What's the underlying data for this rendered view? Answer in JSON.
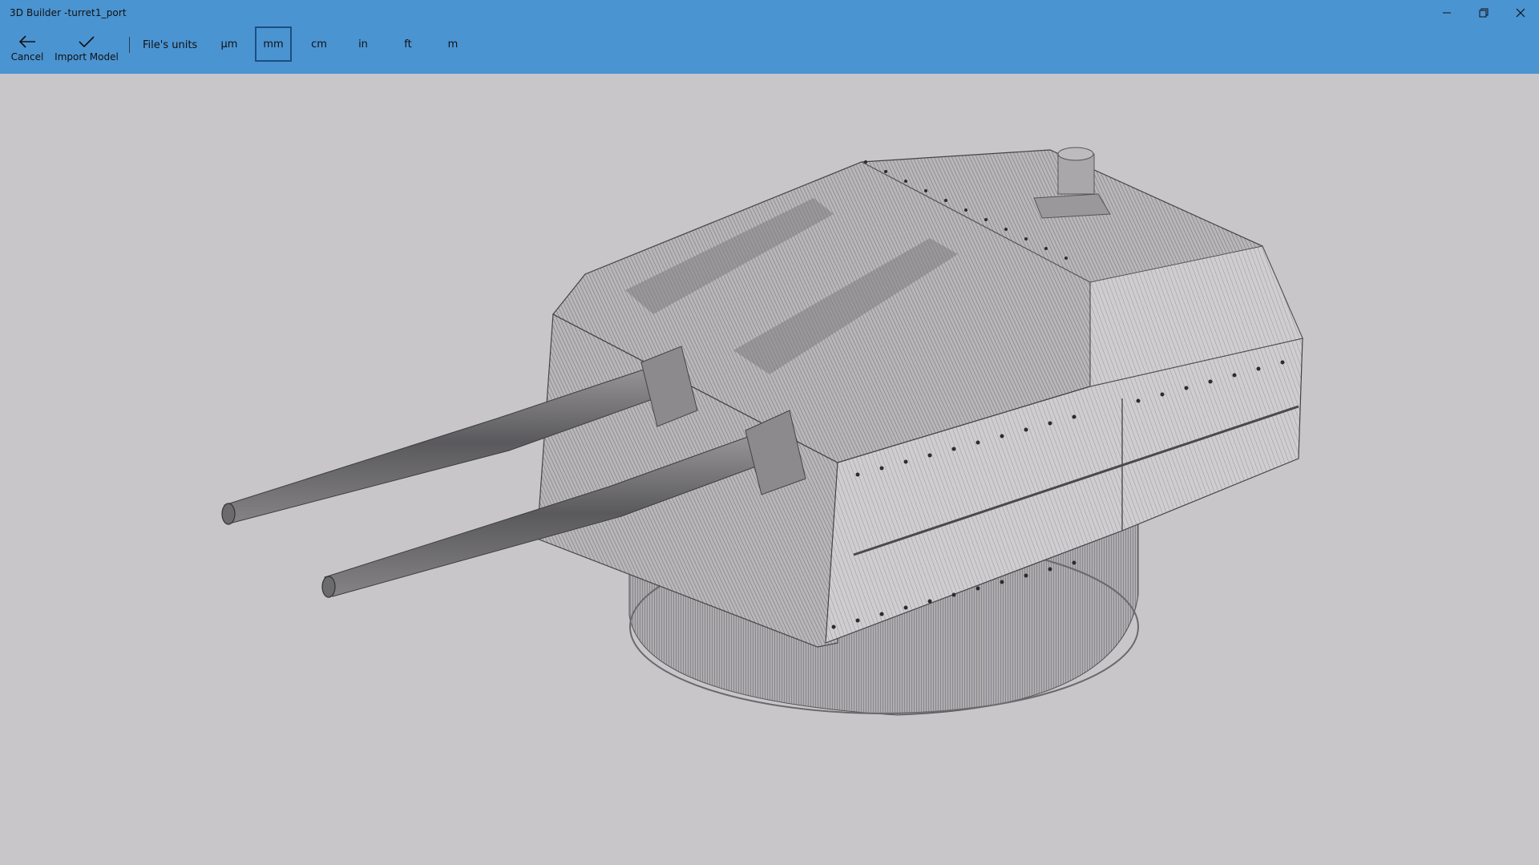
{
  "window": {
    "title": "3D Builder -turret1_port"
  },
  "toolbar": {
    "cancel_label": "Cancel",
    "import_label": "Import Model",
    "units_label": "File's units",
    "units": [
      "µm",
      "mm",
      "cm",
      "in",
      "ft",
      "m"
    ],
    "selected_unit": "mm"
  },
  "colors": {
    "accent": "#4b94d2",
    "viewport_bg": "#c8c6c9",
    "selection_border": "#1c4f80"
  },
  "viewport": {
    "model": "turret1_port"
  }
}
